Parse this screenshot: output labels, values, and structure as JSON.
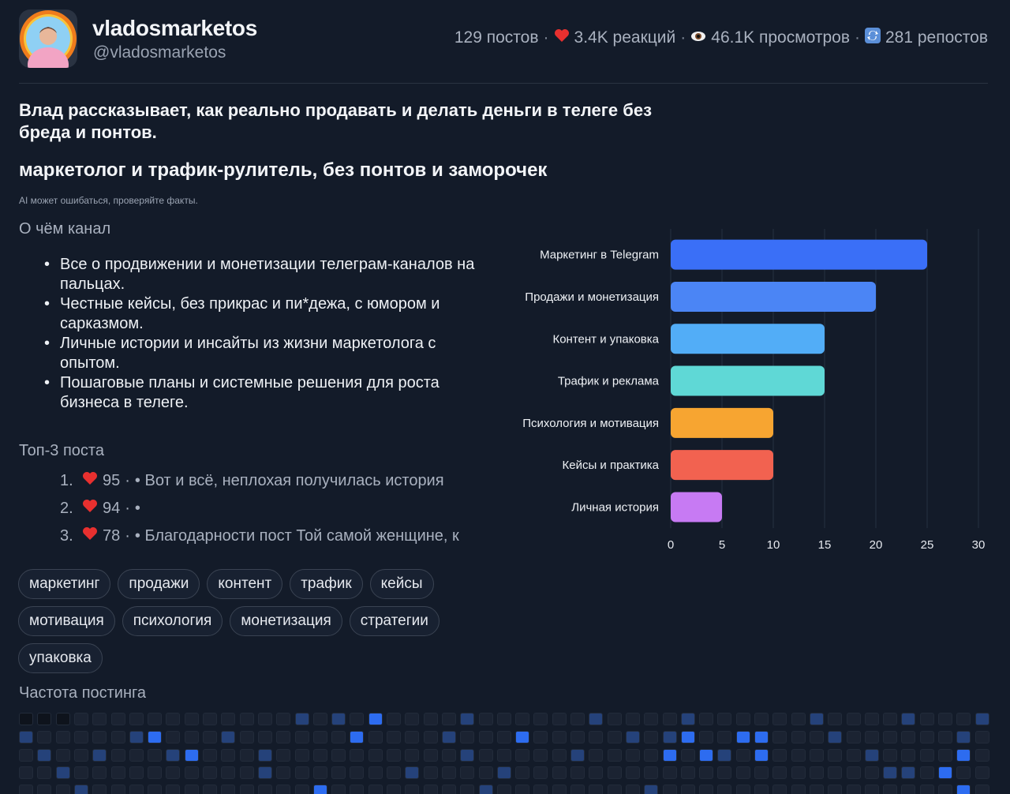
{
  "header": {
    "channel_name": "vladosmarketos",
    "channel_handle": "@vladosmarketos",
    "stats": {
      "posts": "129 постов",
      "reactions": "3.4K реакций",
      "views": "46.1K просмотров",
      "reposts": "281 репостов"
    }
  },
  "summary": {
    "description": "Влад рассказывает, как реально продавать и делать деньги в телеге без бреда и понтов.",
    "tagline": "маркетолог и трафик-рулитель, без понтов и заморочек",
    "disclaimer": "AI может ошибаться, проверяйте факты."
  },
  "about": {
    "title": "О чём канал",
    "items": [
      "Все о продвижении и монетизации телеграм-каналов на пальцах.",
      "Честные кейсы, без прикрас и пи*дежа, с юмором и сарказмом.",
      "Личные истории и инсайты из жизни маркетолога с опытом.",
      "Пошаговые планы и системные решения для роста бизнеса в телеге."
    ]
  },
  "top_posts": {
    "title": "Топ-3 поста",
    "items": [
      {
        "rank": "1.",
        "reactions": "95",
        "text": "• Вот и всё, неплохая получилась история"
      },
      {
        "rank": "2.",
        "reactions": "94",
        "text": "•"
      },
      {
        "rank": "3.",
        "reactions": "78",
        "text": "• Благодарности пост Той самой женщине, к"
      }
    ]
  },
  "tags": [
    "маркетинг",
    "продажи",
    "контент",
    "трафик",
    "кейсы",
    "мотивация",
    "психология",
    "монетизация",
    "стратегии",
    "упаковка"
  ],
  "frequency": {
    "title": "Частота постинга"
  },
  "chart_data": {
    "type": "bar",
    "orientation": "horizontal",
    "categories": [
      "Маркетинг в Telegram",
      "Продажи и монетизация",
      "Контент и упаковка",
      "Трафик и реклама",
      "Психология и мотивация",
      "Кейсы и практика",
      "Личная история"
    ],
    "values": [
      25,
      20,
      15,
      15,
      10,
      10,
      5
    ],
    "colors": [
      "#3a6ff7",
      "#4b85f5",
      "#52adf7",
      "#5fd8d6",
      "#f7a531",
      "#f26250",
      "#c77af3"
    ],
    "xlim": [
      0,
      30
    ],
    "xticks": [
      "0",
      "5",
      "10",
      "15",
      "20",
      "25",
      "30"
    ],
    "grid": true
  }
}
